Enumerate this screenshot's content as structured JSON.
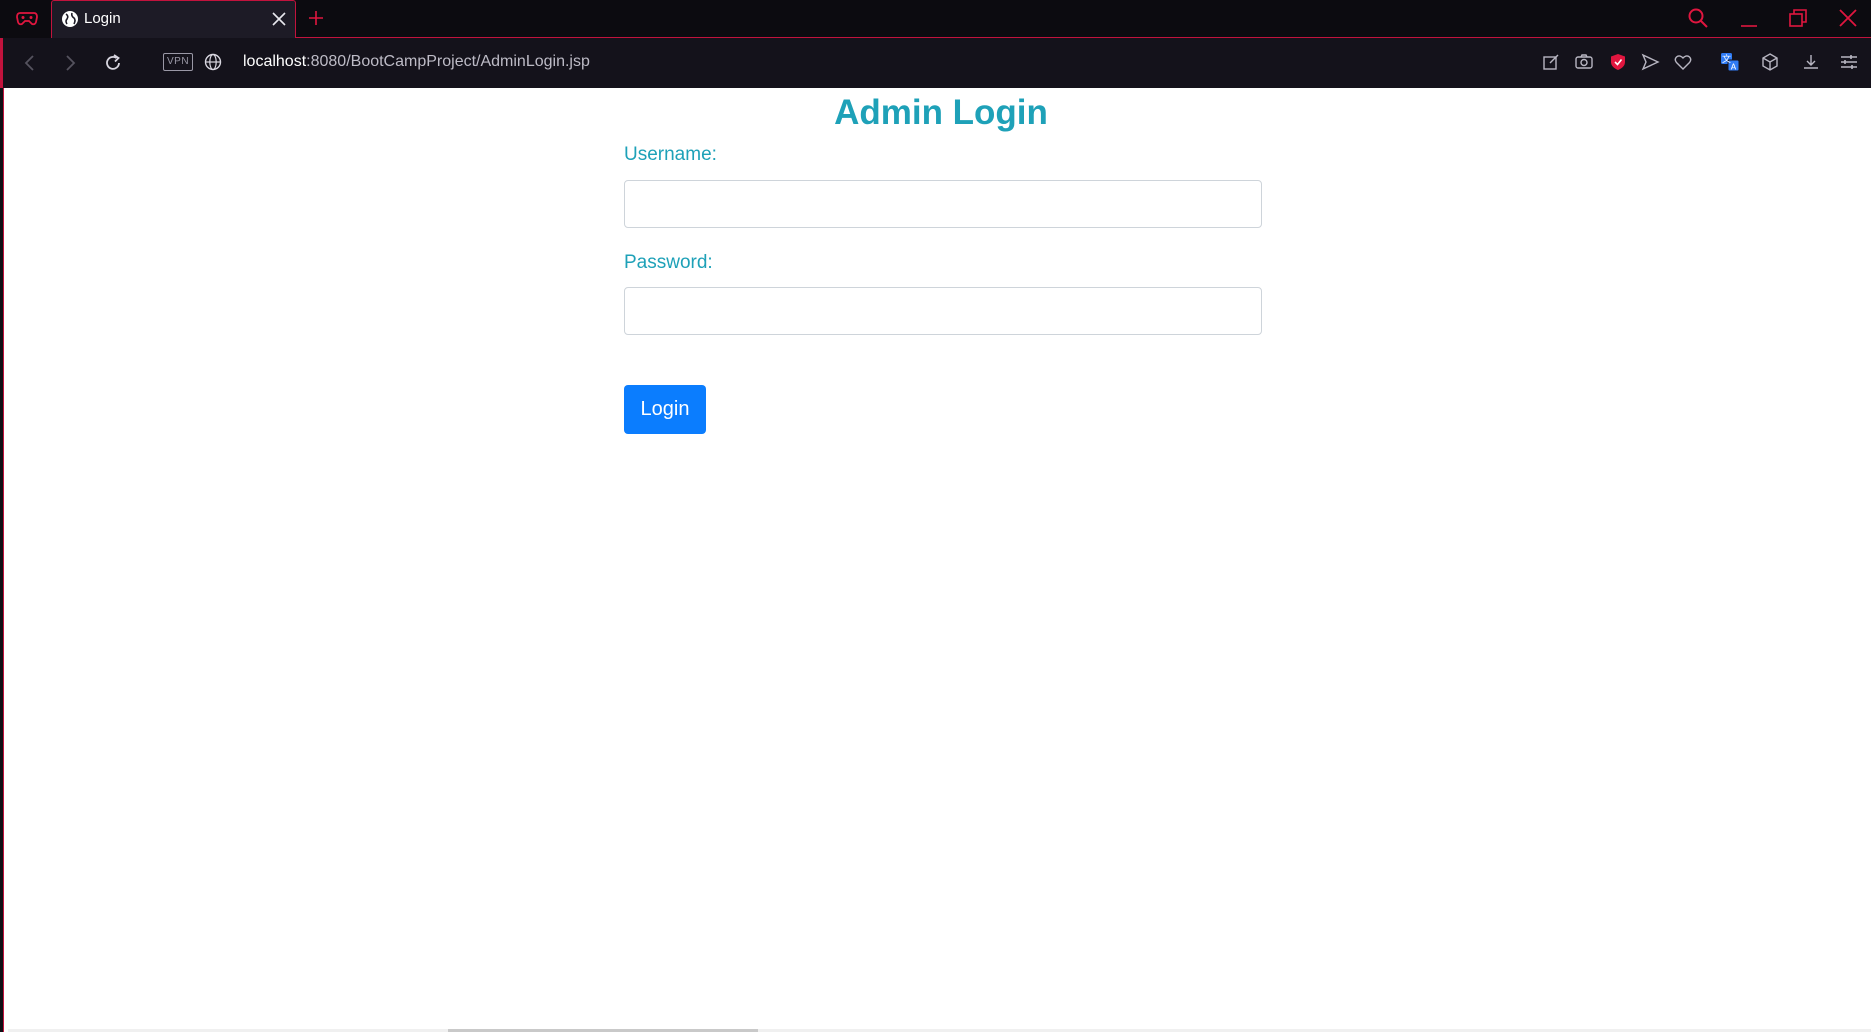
{
  "browser": {
    "tab": {
      "title": "Login",
      "favicon": "globe-icon"
    },
    "address": {
      "vpn_label": "VPN",
      "url_host": "localhost",
      "url_rest": ":8080/BootCampProject/AdminLogin.jsp"
    },
    "accent_color": "#c2133d",
    "toolbar_icons": [
      "snapshot-edit-icon",
      "camera-icon",
      "shield-icon",
      "send-icon",
      "heart-icon",
      "translate-icon",
      "cube-icon",
      "download-icon",
      "settings-sliders-icon"
    ]
  },
  "page": {
    "title": "Admin Login",
    "username_label": "Username:",
    "username_value": "",
    "password_label": "Password:",
    "password_value": "",
    "login_button": "Login",
    "heading_color": "#1ea1b8",
    "button_color": "#0b7dfe"
  }
}
